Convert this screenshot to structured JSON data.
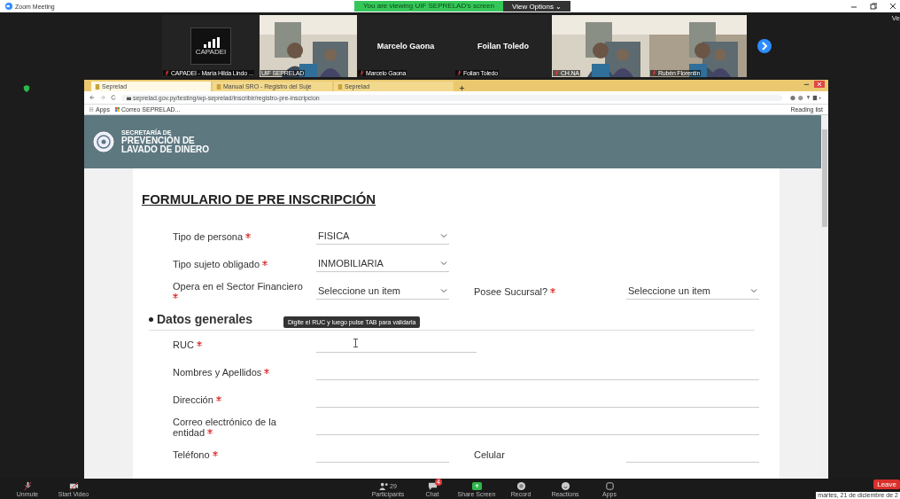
{
  "window": {
    "title": "Zoom Meeting"
  },
  "share_banner": {
    "text": "You are viewing UIF SEPRELAD's screen",
    "options": "View Options ⌄"
  },
  "videos": [
    {
      "kind": "logo",
      "logo_text": "CAPADEI",
      "caption": "CAPADEI - María Hilda Lindo ...",
      "muted": true
    },
    {
      "kind": "picture",
      "caption": "UIF SEPRELAD",
      "muted": false
    },
    {
      "kind": "name",
      "name": "Marcelo Gaona",
      "caption": "Marcelo Gaona",
      "muted": true
    },
    {
      "kind": "name",
      "name": "Foilan Toledo",
      "caption": "Foilan Toledo",
      "muted": true
    },
    {
      "kind": "picture",
      "caption": "CH.NA",
      "muted": true
    },
    {
      "kind": "picture",
      "caption": "Rubén Florentín",
      "muted": true
    }
  ],
  "browser": {
    "tabs": [
      {
        "label": "Seprelad",
        "selected": true
      },
      {
        "label": "Manual SRO - Registro del Suje",
        "selected": false
      },
      {
        "label": "Seprelad",
        "selected": false
      }
    ],
    "url": "seprelad.gov.py/testing/wp-seprelad/inscribir/registro-pre-inscripcion",
    "bookmarks": [
      {
        "label": "Apps"
      },
      {
        "label": "Correo SEPRELAD..."
      }
    ],
    "reading_list": "Reading list"
  },
  "site_header": {
    "line_1": "SECRETARÍA DE",
    "line_2": "PREVENCIÓN DE",
    "line_3": "LAVADO DE DINERO"
  },
  "form": {
    "title": "FORMULARIO DE PRE INSCRIPCIÓN",
    "rows": [
      {
        "fields": [
          {
            "label": "Tipo de persona",
            "required": true,
            "kind": "select",
            "value": "FISICA"
          }
        ]
      },
      {
        "fields": [
          {
            "label": "Tipo sujeto obligado",
            "required": true,
            "kind": "select",
            "value": "INMOBILIARIA"
          }
        ]
      },
      {
        "fields": [
          {
            "label": "Opera en el Sector Financiero",
            "required": true,
            "kind": "select",
            "value": "Seleccione un item"
          },
          {
            "label": "Posee Sucursal?",
            "required": true,
            "kind": "select",
            "value": "Seleccione un item"
          }
        ]
      },
      {
        "section": "Datos generales"
      },
      {
        "fields": [
          {
            "label": "RUC",
            "required": true,
            "kind": "text",
            "tooltip": "Digite el RUC y luego pulse TAB para validarla"
          }
        ]
      },
      {
        "fields": [
          {
            "label": "Nombres y Apellidos",
            "required": true,
            "kind": "text"
          }
        ]
      },
      {
        "fields": [
          {
            "label": "Dirección",
            "required": true,
            "kind": "text"
          }
        ]
      },
      {
        "fields": [
          {
            "label": "Correo electrónico de la entidad",
            "required": true,
            "kind": "text"
          }
        ]
      },
      {
        "fields": [
          {
            "label": "Teléfono",
            "required": true,
            "kind": "text"
          },
          {
            "label": "Celular",
            "required": false,
            "kind": "text"
          }
        ]
      }
    ]
  },
  "view_button": "Ve",
  "toolbar": {
    "buttons": [
      {
        "kind": "mic",
        "label": "Unmute"
      },
      {
        "kind": "video",
        "label": "Start Video"
      },
      {
        "kind": "participants",
        "label": "Participants",
        "count": "29"
      },
      {
        "kind": "chat",
        "label": "Chat",
        "badge": "4"
      },
      {
        "kind": "share",
        "label": "Share Screen"
      },
      {
        "kind": "record",
        "label": "Record"
      },
      {
        "kind": "reactions",
        "label": "Reactions"
      },
      {
        "kind": "apps",
        "label": "Apps"
      }
    ],
    "leave": "Leave",
    "date_tooltip": "martes, 21 de diciembre de 2"
  }
}
